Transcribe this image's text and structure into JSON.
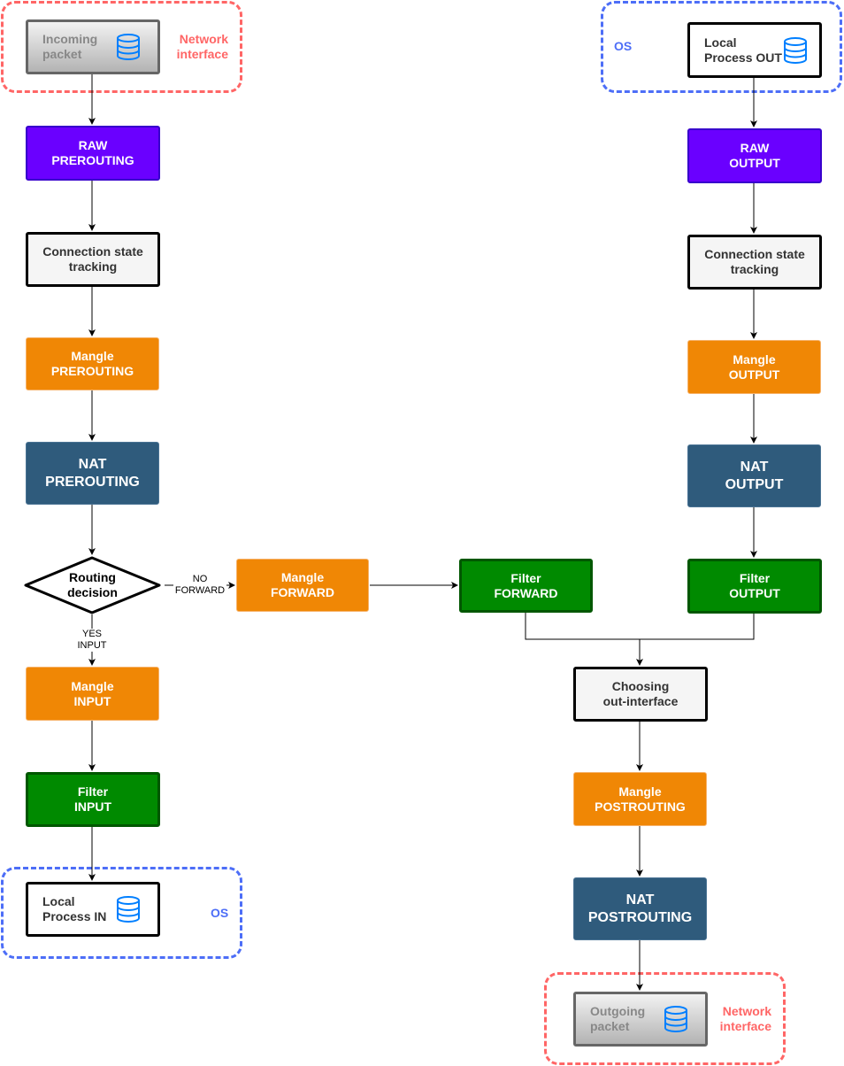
{
  "colors": {
    "raw": "#6a00ff",
    "mangle": "#f08705",
    "nat": "#2f5b7c",
    "filter": "#008a00",
    "network_group": "#ff6666",
    "os_group": "#4d6ef7",
    "database_icon": "#007fff"
  },
  "groups": {
    "network_in": "Network\ninterface",
    "os_out": "OS",
    "os_in": "OS",
    "network_out": "Network\ninterface"
  },
  "nodes": {
    "incoming_packet": "Incoming\npacket",
    "raw_prerouting": "RAW\nPREROUTING",
    "conntrack_left": "Connection state\ntracking",
    "mangle_prerouting": "Mangle\nPREROUTING",
    "nat_prerouting": "NAT\nPREROUTING",
    "routing_decision": "Routing\ndecision",
    "mangle_input": "Mangle\nINPUT",
    "filter_input": "Filter\nINPUT",
    "local_process_in": "Local\nProcess IN",
    "mangle_forward": "Mangle\nFORWARD",
    "filter_forward": "Filter\nFORWARD",
    "local_process_out": "Local\nProcess OUT",
    "raw_output": "RAW\nOUTPUT",
    "conntrack_right": "Connection state\ntracking",
    "mangle_output": "Mangle\nOUTPUT",
    "nat_output": "NAT\nOUTPUT",
    "filter_output": "Filter\nOUTPUT",
    "choosing_out_interface": "Choosing\nout-interface",
    "mangle_postrouting": "Mangle\nPOSTROUTING",
    "nat_postrouting": "NAT\nPOSTROUTING",
    "outgoing_packet": "Outgoing\npacket"
  },
  "edge_labels": {
    "no_forward": "NO\nFORWARD",
    "yes_input": "YES\nINPUT"
  }
}
